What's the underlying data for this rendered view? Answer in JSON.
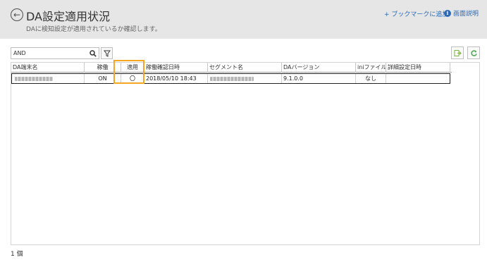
{
  "header": {
    "title": "DA設定適用状況",
    "subtitle": "DAに検知設定が適用されているか確認します。",
    "bookmark_label": "+ ブックマークに追加",
    "help_label": "画面説明"
  },
  "search": {
    "value": "AND"
  },
  "table": {
    "columns": [
      "DA端末名",
      "稼働",
      "適用",
      "稼働確認日時",
      "セグメント名",
      "DAバージョン",
      "iniファイル",
      "詳細設定日時"
    ],
    "rows": [
      {
        "da_name": "",
        "status": "ON",
        "applied": "〇",
        "checked_at": "2018/05/10 18:43",
        "segment": "",
        "version": "9.1.0.0",
        "ini_file": "なし",
        "detail_set_at": ""
      }
    ]
  },
  "footer": {
    "count_label": "1 個"
  },
  "colors": {
    "header_bg": "#e6e6e6",
    "link": "#2a6ab8",
    "highlight": "#f5a623",
    "export_icon": "#7cb342",
    "refresh_icon": "#4caf50"
  }
}
